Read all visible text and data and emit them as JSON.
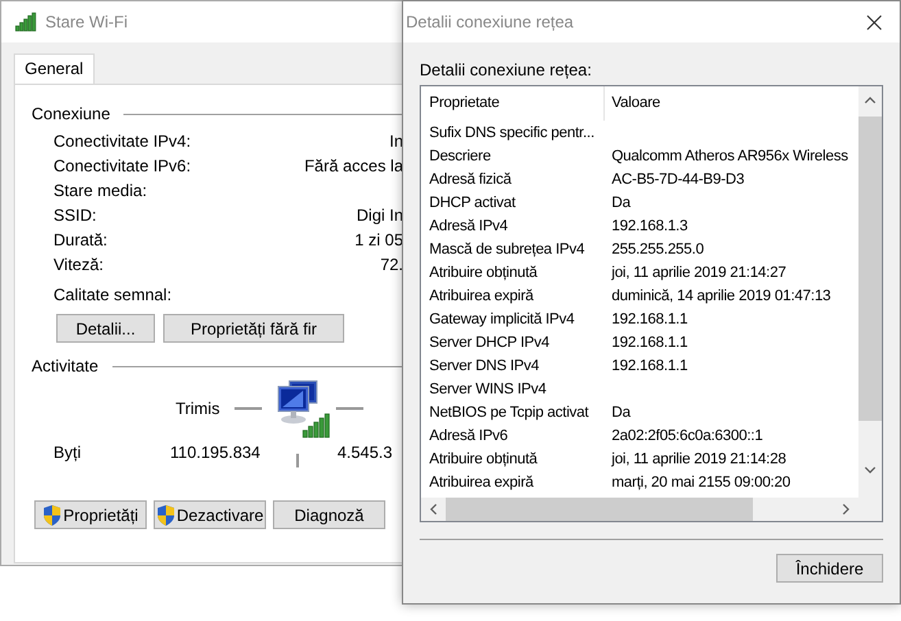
{
  "status_window": {
    "title": "Stare Wi-Fi",
    "tabs": [
      {
        "label": "General",
        "selected": true
      }
    ],
    "connection": {
      "title": "Conexiune",
      "rows": [
        {
          "label": "Conectivitate IPv4:",
          "value": "In"
        },
        {
          "label": "Conectivitate IPv6:",
          "value": "Fără acces la"
        },
        {
          "label": "Stare media:",
          "value": ""
        },
        {
          "label": "SSID:",
          "value": "Digi In"
        },
        {
          "label": "Durată:",
          "value": "1 zi 05"
        },
        {
          "label": "Viteză:",
          "value": "72."
        }
      ],
      "signal_label": "Calitate semnal:",
      "buttons": [
        "Detalii...",
        "Proprietăți fără fir"
      ]
    },
    "activity": {
      "title": "Activitate",
      "sent_label": "Trimis",
      "bytes_label": "Byți",
      "bytes_sent": "110.195.834",
      "bytes_received": "4.545.3"
    },
    "buttons": [
      {
        "label": "Proprietăți",
        "kind": "shield"
      },
      {
        "label": "Dezactivare",
        "kind": "shield"
      },
      {
        "label": "Diagnoză",
        "kind": "plain"
      }
    ]
  },
  "details_dialog": {
    "title": "Detalii conexiune rețea",
    "caption": "Detalii conexiune rețea:",
    "columns": [
      "Proprietate",
      "Valoare"
    ],
    "rows": [
      {
        "property": "Sufix DNS specific pentr...",
        "value": ""
      },
      {
        "property": "Descriere",
        "value": "Qualcomm Atheros AR956x Wireless"
      },
      {
        "property": "Adresă fizică",
        "value": "AC-B5-7D-44-B9-D3"
      },
      {
        "property": "DHCP activat",
        "value": "Da"
      },
      {
        "property": "Adresă IPv4",
        "value": "192.168.1.3"
      },
      {
        "property": "Mască de subrețea IPv4",
        "value": "255.255.255.0"
      },
      {
        "property": "Atribuire obținută",
        "value": "joi, 11 aprilie 2019 21:14:27"
      },
      {
        "property": "Atribuirea expiră",
        "value": "duminică, 14 aprilie 2019 01:47:13"
      },
      {
        "property": "Gateway implicită IPv4",
        "value": "192.168.1.1"
      },
      {
        "property": "Server DHCP IPv4",
        "value": "192.168.1.1"
      },
      {
        "property": "Server DNS IPv4",
        "value": "192.168.1.1"
      },
      {
        "property": "Server WINS IPv4",
        "value": ""
      },
      {
        "property": "NetBIOS pe Tcpip activat",
        "value": "Da"
      },
      {
        "property": "Adresă IPv6",
        "value": "2a02:2f05:6c0a:6300::1"
      },
      {
        "property": "Atribuire obținută",
        "value": "joi, 11 aprilie 2019 21:14:28"
      },
      {
        "property": "Atribuirea expiră",
        "value": "marți, 20 mai 2155 09:00:20"
      }
    ],
    "close_button": "Închidere"
  }
}
